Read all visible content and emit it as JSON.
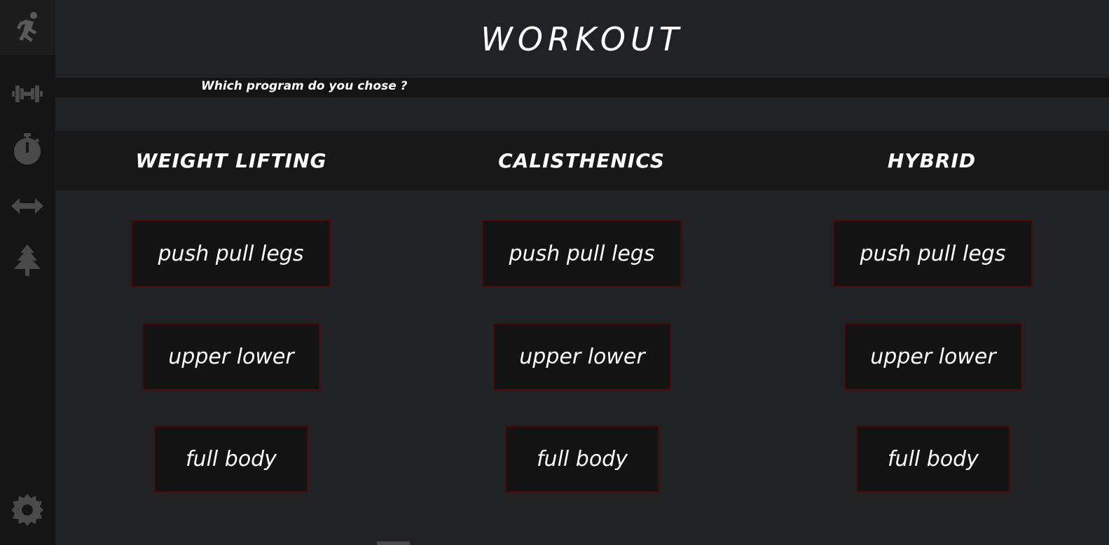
{
  "sidebar": {
    "icons": [
      "running-person-icon",
      "dumbbell-icon",
      "stopwatch-icon",
      "arrows-horizontal-icon",
      "tree-icon",
      "settings-gear-icon"
    ]
  },
  "header": {
    "title": "WORKOUT"
  },
  "prompt": {
    "question": "Which program do you chose ?"
  },
  "categories": [
    {
      "title": "WEIGHT LIFTING",
      "programs": [
        "push pull legs",
        "upper lower",
        "full body"
      ]
    },
    {
      "title": "CALISTHENICS",
      "programs": [
        "push pull legs",
        "upper lower",
        "full body"
      ]
    },
    {
      "title": "HYBRID",
      "programs": [
        "push pull legs",
        "upper lower",
        "full body"
      ]
    }
  ],
  "colors": {
    "background": "#212226",
    "sidebar": "#151515",
    "button_border": "#4a0a0a",
    "icon": "#4a4a4a"
  }
}
